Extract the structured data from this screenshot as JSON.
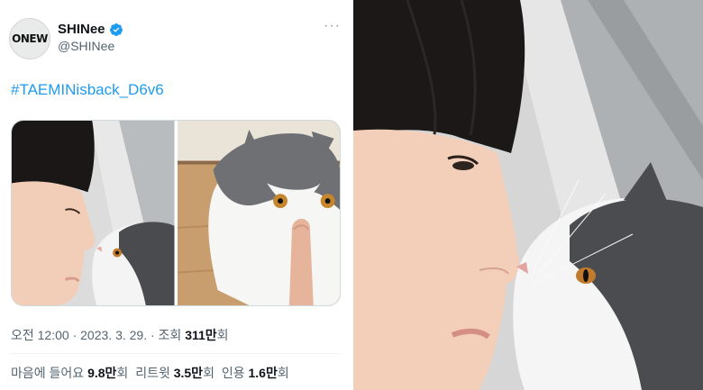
{
  "tweet": {
    "avatar_text": "ONEW",
    "display_name": "SHINee",
    "handle": "@SHINee",
    "more_icon": "more-dots-icon",
    "verified_icon": "verified-badge-icon",
    "hashtag": "#TAEMINisback_D6v6",
    "meta": {
      "time": "오전 12:00",
      "sep1": " · ",
      "date": "2023. 3. 29.",
      "sep2": " · ",
      "views_label": "조회 ",
      "views_value": "311만",
      "views_unit": "회"
    },
    "stats": {
      "likes_label": "마음에 들어요 ",
      "likes_value": "9.8만",
      "likes_unit": "회",
      "retweets_label": "리트윗 ",
      "retweets_value": "3.5만",
      "retweets_unit": "회",
      "quotes_label": "인용 ",
      "quotes_value": "1.6만",
      "quotes_unit": "회"
    }
  },
  "colors": {
    "link": "#1d9bf0",
    "secondary_text": "#536471",
    "primary_text": "#0f1419"
  }
}
